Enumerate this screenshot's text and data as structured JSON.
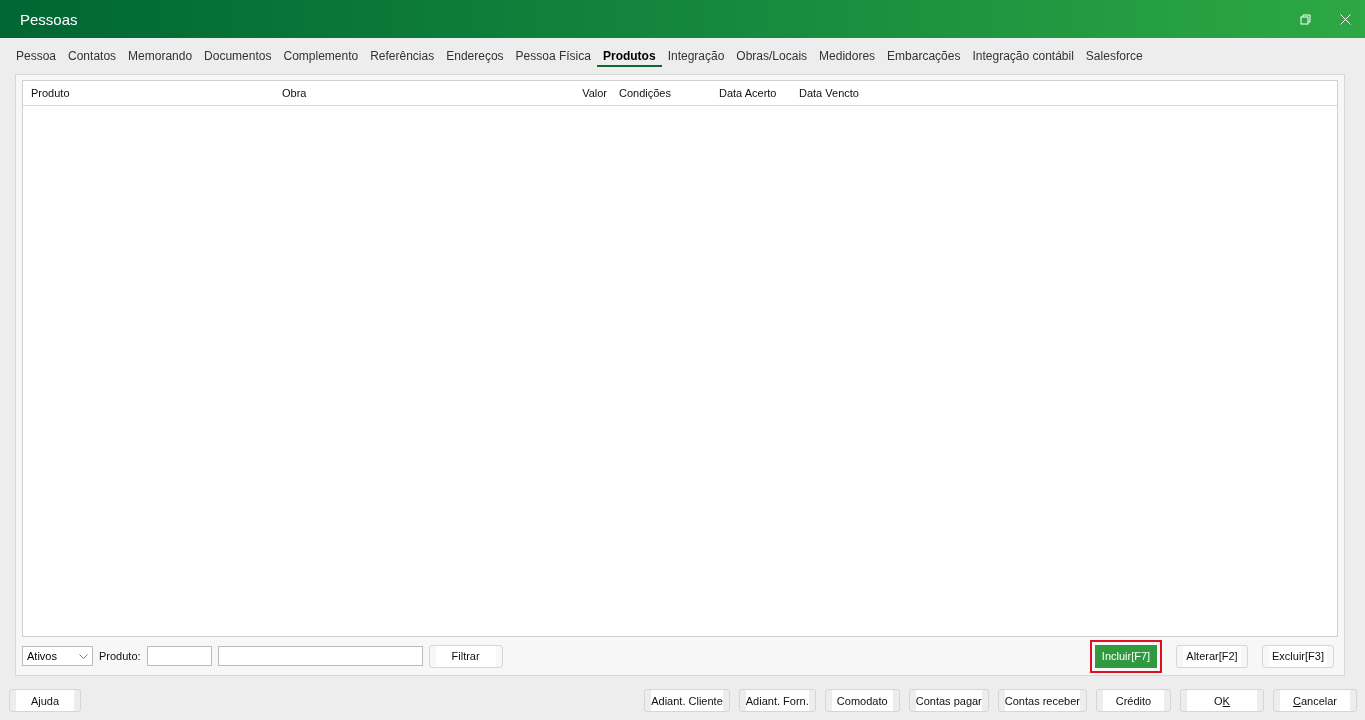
{
  "window": {
    "title": "Pessoas"
  },
  "tabs": [
    {
      "label": "Pessoa",
      "selected": false
    },
    {
      "label": "Contatos",
      "selected": false
    },
    {
      "label": "Memorando",
      "selected": false
    },
    {
      "label": "Documentos",
      "selected": false
    },
    {
      "label": "Complemento",
      "selected": false
    },
    {
      "label": "Referências",
      "selected": false
    },
    {
      "label": "Endereços",
      "selected": false
    },
    {
      "label": "Pessoa Física",
      "selected": false
    },
    {
      "label": "Produtos",
      "selected": true
    },
    {
      "label": "Integração",
      "selected": false
    },
    {
      "label": "Obras/Locais",
      "selected": false
    },
    {
      "label": "Medidores",
      "selected": false
    },
    {
      "label": "Embarcações",
      "selected": false
    },
    {
      "label": "Integração contábil",
      "selected": false
    },
    {
      "label": "Salesforce",
      "selected": false
    }
  ],
  "table": {
    "columns": [
      "Produto",
      "Obra",
      "Valor",
      "Condições",
      "Data Acerto",
      "Data Vencto"
    ]
  },
  "filter": {
    "status": "Ativos",
    "product_label": "Produto:",
    "button": "Filtrar"
  },
  "actions": [
    {
      "label": "Incluir[F7]",
      "primary": true,
      "highlighted": true
    },
    {
      "label": "Alterar[F2]",
      "primary": false,
      "highlighted": false
    },
    {
      "label": "Excluir[F3]",
      "primary": false,
      "highlighted": false
    }
  ],
  "help_button": "Ajuda",
  "footer_buttons": [
    {
      "parts": [
        {
          "text": "Adiant. Cliente",
          "underlined": false
        }
      ]
    },
    {
      "parts": [
        {
          "text": "Adiant. Forn.",
          "underlined": false
        }
      ]
    },
    {
      "parts": [
        {
          "text": "Comodato",
          "underlined": false
        }
      ]
    },
    {
      "parts": [
        {
          "text": "Contas pagar",
          "underlined": false
        }
      ]
    },
    {
      "parts": [
        {
          "text": "Contas receber",
          "underlined": false
        }
      ]
    },
    {
      "parts": [
        {
          "text": "Crédito",
          "underlined": false
        }
      ]
    },
    {
      "parts": [
        {
          "text": "O",
          "underlined": false
        },
        {
          "text": "K",
          "underlined": true
        }
      ]
    },
    {
      "parts": [
        {
          "text": "C",
          "underlined": true
        },
        {
          "text": "ancelar",
          "underlined": false
        }
      ]
    }
  ]
}
